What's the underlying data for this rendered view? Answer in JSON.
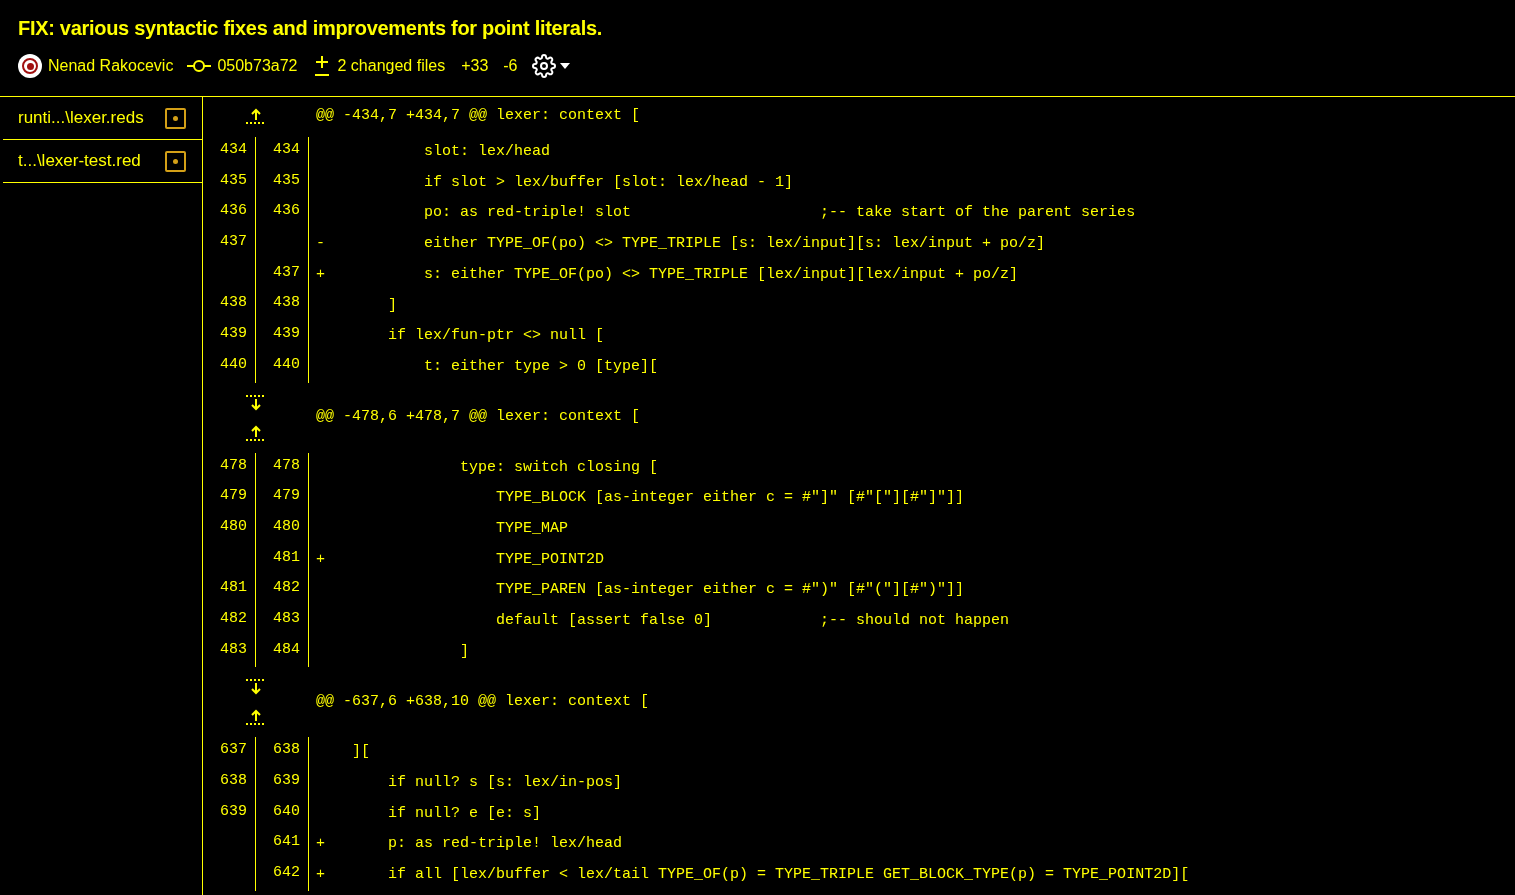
{
  "commit": {
    "title": "FIX: various syntactic fixes and improvements for point literals.",
    "author": "Nenad Rakocevic",
    "hash": "050b73a72",
    "changed_files": "2 changed files",
    "additions": "+33",
    "deletions": "-6"
  },
  "files": [
    {
      "name": "runti...\\lexer.reds"
    },
    {
      "name": "t...\\lexer-test.red"
    }
  ],
  "hunks": [
    {
      "expand_down": false,
      "expand_up": true,
      "header": "@@ -434,7 +434,7 @@ lexer: context [",
      "lines": [
        {
          "old": "434",
          "new": "434",
          "code": "        slot: lex/head"
        },
        {
          "old": "435",
          "new": "435",
          "code": "        if slot > lex/buffer [slot: lex/head - 1]"
        },
        {
          "old": "436",
          "new": "436",
          "code": "        po: as red-triple! slot                     ;-- take start of the parent series"
        },
        {
          "old": "437",
          "marker": "-",
          "code": "        either TYPE_OF(po) <> TYPE_TRIPLE [s: lex/input][s: lex/input + po/z]"
        },
        {
          "new": "437",
          "marker": "+",
          "code": "        s: either TYPE_OF(po) <> TYPE_TRIPLE [lex/input][lex/input + po/z]"
        },
        {
          "old": "438",
          "new": "438",
          "code": "    ]"
        },
        {
          "old": "439",
          "new": "439",
          "code": "    if lex/fun-ptr <> null ["
        },
        {
          "old": "440",
          "new": "440",
          "code": "        t: either type > 0 [type]["
        }
      ]
    },
    {
      "expand_down": true,
      "expand_up": true,
      "header": "@@ -478,6 +478,7 @@ lexer: context [",
      "lines": [
        {
          "old": "478",
          "new": "478",
          "code": "            type: switch closing ["
        },
        {
          "old": "479",
          "new": "479",
          "code": "                TYPE_BLOCK [as-integer either c = #\"]\" [#\"[\"][#\"]\"]]"
        },
        {
          "old": "480",
          "new": "480",
          "code": "                TYPE_MAP"
        },
        {
          "new": "481",
          "marker": "+",
          "code": "                TYPE_POINT2D"
        },
        {
          "old": "481",
          "new": "482",
          "code": "                TYPE_PAREN [as-integer either c = #\")\" [#\"(\"][#\")\"]]"
        },
        {
          "old": "482",
          "new": "483",
          "code": "                default [assert false 0]            ;-- should not happen"
        },
        {
          "old": "483",
          "new": "484",
          "code": "            ]"
        }
      ]
    },
    {
      "expand_down": true,
      "expand_up": true,
      "header": "@@ -637,6 +638,10 @@ lexer: context [",
      "lines": [
        {
          "old": "637",
          "new": "638",
          "code": "]["
        },
        {
          "old": "638",
          "new": "639",
          "code": "    if null? s [s: lex/in-pos]"
        },
        {
          "old": "639",
          "new": "640",
          "code": "    if null? e [e: s]"
        },
        {
          "new": "641",
          "marker": "+",
          "code": "    p: as red-triple! lex/head"
        },
        {
          "new": "642",
          "marker": "+",
          "code": "    if all [lex/buffer < lex/tail TYPE_OF(p) = TYPE_TRIPLE GET_BLOCK_TYPE(p) = TYPE_POINT2D]["
        }
      ]
    }
  ]
}
